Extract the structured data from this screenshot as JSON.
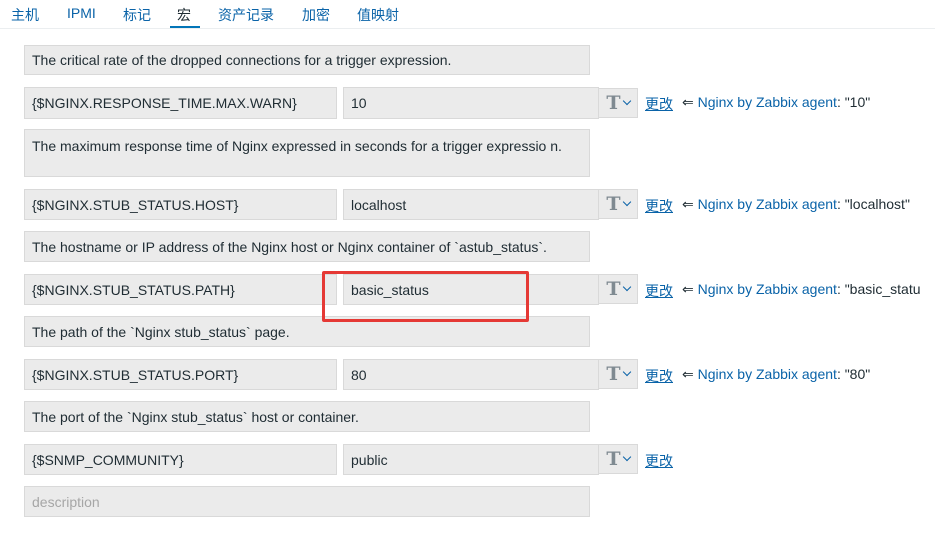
{
  "tabs": [
    {
      "label": "主机",
      "active": false
    },
    {
      "label": "IPMI",
      "active": false
    },
    {
      "label": "标记",
      "active": false
    },
    {
      "label": "宏",
      "active": true
    },
    {
      "label": "资产记录",
      "active": false
    },
    {
      "label": "加密",
      "active": false
    },
    {
      "label": "值映射",
      "active": false
    }
  ],
  "macros": {
    "top_description": "The critical rate of the dropped connections for a trigger expression.",
    "rows": [
      {
        "name": "{$NGINX.RESPONSE_TIME.MAX.WARN}",
        "value": "10",
        "type_icon": "text-type-icon",
        "revert_label": "更改",
        "inherit_arrow": "⇐",
        "template": "Nginx by Zabbix agent",
        "template_value": ": \"10\"",
        "description": "The maximum response time of Nginx expressed in seconds for a trigger expressio n."
      },
      {
        "name": "{$NGINX.STUB_STATUS.HOST}",
        "value": "localhost",
        "type_icon": "text-type-icon",
        "revert_label": "更改",
        "inherit_arrow": "⇐",
        "template": "Nginx by Zabbix agent",
        "template_value": ": \"localhost\"",
        "description": "The hostname or IP address of the Nginx host or Nginx container of `astub_status`."
      },
      {
        "name": "{$NGINX.STUB_STATUS.PATH}",
        "value": "basic_status",
        "type_icon": "text-type-icon",
        "revert_label": "更改",
        "inherit_arrow": "⇐",
        "template": "Nginx by Zabbix agent",
        "template_value": ": \"basic_statu",
        "description": "The path of the `Nginx stub_status` page."
      },
      {
        "name": "{$NGINX.STUB_STATUS.PORT}",
        "value": "80",
        "type_icon": "text-type-icon",
        "revert_label": "更改",
        "inherit_arrow": "⇐",
        "template": "Nginx by Zabbix agent",
        "template_value": ": \"80\"",
        "description": "The port of the `Nginx stub_status` host or container."
      },
      {
        "name": "{$SNMP_COMMUNITY}",
        "value": "public",
        "type_icon": "text-type-icon",
        "revert_label": "更改",
        "description_placeholder": "description"
      }
    ]
  },
  "type_glyph": "T",
  "colors": {
    "link": "#0a63a8",
    "highlight": "#e53935",
    "field_bg": "#ebebeb"
  }
}
